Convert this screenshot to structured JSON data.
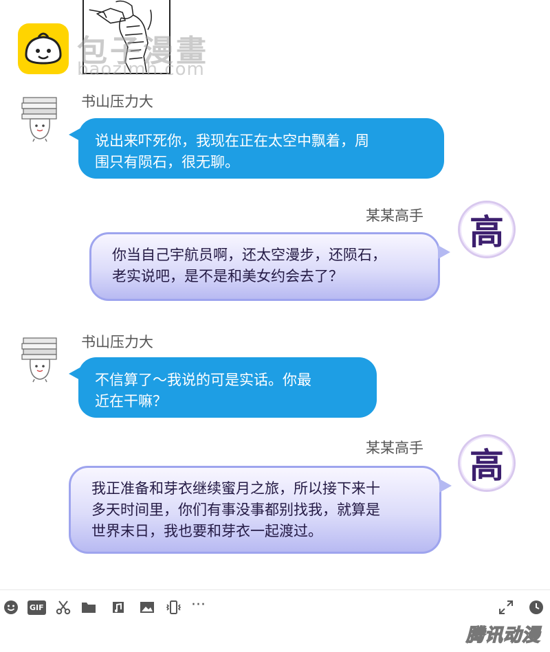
{
  "watermark": {
    "title": "包子漫畫",
    "sub": "baozimh.com"
  },
  "messages": [
    {
      "sender": "书山压力大",
      "side": "left",
      "lines": [
        "说出来吓死你，我现在正在太空中飘着，周",
        "围只有陨石，很无聊。"
      ]
    },
    {
      "sender": "某某高手",
      "side": "right",
      "lines": [
        "你当自己宇航员啊，还太空漫步，还陨石，",
        "老实说吧，是不是和美女约会去了？"
      ]
    },
    {
      "sender": "书山压力大",
      "side": "left",
      "lines": [
        "不信算了～我说的可是实话。你最",
        "近在干嘛？"
      ]
    },
    {
      "sender": "某某高手",
      "side": "right",
      "lines": [
        "我正准备和芽衣继续蜜月之旅，所以接下来十",
        "多天时间里，你们有事没事都别找我，就算是",
        "世界末日，我也要和芽衣一起渡过。"
      ]
    }
  ],
  "avatar_gao_char": "高",
  "toolbar": {
    "gif_label": "GIF",
    "more_label": "···",
    "icons": [
      "emoji-icon",
      "gif-icon",
      "scissors-icon",
      "folder-icon",
      "music-icon",
      "image-icon",
      "shake-icon",
      "more-icon",
      "expand-icon",
      "clock-icon"
    ]
  },
  "brand": "腾讯动漫",
  "colors": {
    "blue_bubble": "#1e9ee4",
    "purple_bubble_border": "#9ea4ee",
    "watermark_yellow": "#ffd400"
  }
}
